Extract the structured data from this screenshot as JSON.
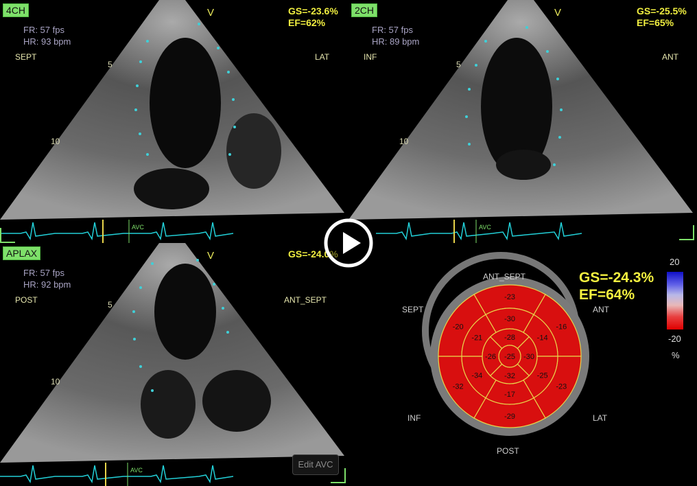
{
  "views": [
    {
      "tag": "4CH",
      "gs": "GS=-23.6%",
      "ef": "EF=62%",
      "fr": "FR: 57 fps",
      "hr": "HR: 93 bpm",
      "left_label": "SEPT",
      "right_label": "LAT",
      "v": "V",
      "depth5": "5",
      "depth10": "10",
      "avc": "AVC"
    },
    {
      "tag": "2CH",
      "gs": "GS=-25.5%",
      "ef": "EF=65%",
      "fr": "FR: 57 fps",
      "hr": "HR: 89 bpm",
      "left_label": "INF",
      "right_label": "ANT",
      "v": "V",
      "depth5": "5",
      "depth10": "10",
      "avc": "AVC"
    },
    {
      "tag": "APLAX",
      "gs": "GS=-24.0%",
      "ef": "",
      "fr": "FR: 57 fps",
      "hr": "HR: 92 bpm",
      "left_label": "POST",
      "right_label": "ANT_SEPT",
      "v": "V",
      "depth5": "5",
      "depth10": "10",
      "avc": "AVC"
    }
  ],
  "bullseye": {
    "gs": "GS=-24.3%",
    "ef": "EF=64%",
    "labels": {
      "top": "ANT_SEPT",
      "upper_left": "SEPT",
      "upper_right": "ANT",
      "lower_left": "INF",
      "lower_right": "LAT",
      "bottom": "POST"
    },
    "scale": {
      "max": "20",
      "min": "-20",
      "unit": "%"
    },
    "segments": {
      "basal": [
        "-23",
        "-16",
        "-23",
        "-29",
        "-32",
        "-20"
      ],
      "mid": [
        "-30",
        "-14",
        "-25",
        "-17",
        "-34",
        "-21"
      ],
      "apical": [
        "-28",
        "-30",
        "-32",
        "-26"
      ],
      "apex": "-25"
    },
    "colors": {
      "segment": "#d80f0f",
      "line": "#e8d44a",
      "ring": "#777777"
    }
  },
  "controls": {
    "edit_avc": "Edit AVC",
    "play": "play"
  },
  "colors": {
    "tag_bg": "#7ee06a",
    "gs_text": "#f0ee40",
    "tracking": "#3fd0d8",
    "ecg": "#22d0d8"
  }
}
